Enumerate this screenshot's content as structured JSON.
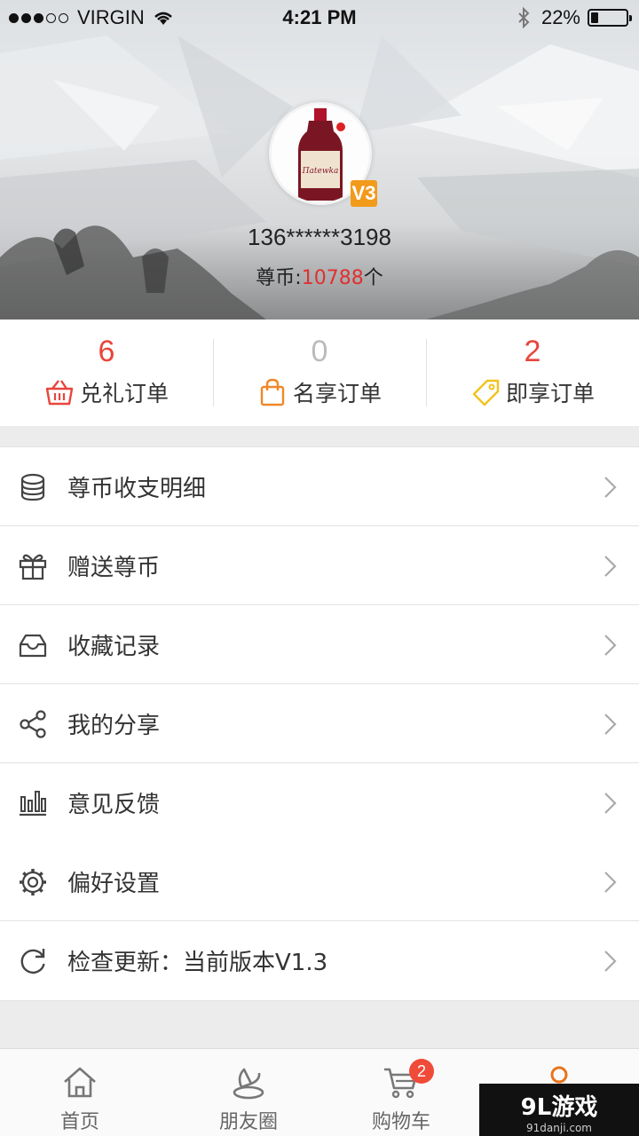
{
  "status": {
    "carrier": "VIRGIN",
    "time": "4:21 PM",
    "battery": "22%",
    "battery_level": 0.22,
    "signal_bars": 3
  },
  "profile": {
    "phone": "136******3198",
    "coins_prefix": "尊币:",
    "coins_value": "10788",
    "coins_suffix": "个",
    "vip_badge": "V3",
    "avatar_label": "Пatewka"
  },
  "orders": [
    {
      "count": "6",
      "label": "兑礼订单",
      "color": "#e8453c",
      "icon": "basket-icon"
    },
    {
      "count": "0",
      "label": "名享订单",
      "color": "#bbbbbb",
      "icon": "shopping-bag-icon"
    },
    {
      "count": "2",
      "label": "即享订单",
      "color": "#e8453c",
      "icon": "tag-icon"
    }
  ],
  "menu": [
    {
      "label": "尊币收支明细",
      "icon": "coin-stack-icon"
    },
    {
      "label": "赠送尊币",
      "icon": "gift-icon"
    },
    {
      "label": "收藏记录",
      "icon": "inbox-icon"
    },
    {
      "label": "我的分享",
      "icon": "share-icon"
    },
    {
      "label": "意见反馈",
      "icon": "bar-chart-icon"
    },
    {
      "label": "偏好设置",
      "icon": "gear-icon"
    },
    {
      "label": "检查更新：当前版本V1.3",
      "icon": "refresh-icon"
    }
  ],
  "tabs": [
    {
      "label": "首页",
      "icon": "home-icon"
    },
    {
      "label": "朋友圈",
      "icon": "friends-icon"
    },
    {
      "label": "购物车",
      "icon": "cart-icon",
      "badge": "2"
    },
    {
      "label": "",
      "icon": "profile-icon"
    }
  ],
  "watermark": {
    "title": "9L游戏",
    "sub": "91danji.com"
  },
  "colors": {
    "accent": "#e8453c",
    "orange": "#f29a1b",
    "active_tab": "#e8741c"
  }
}
